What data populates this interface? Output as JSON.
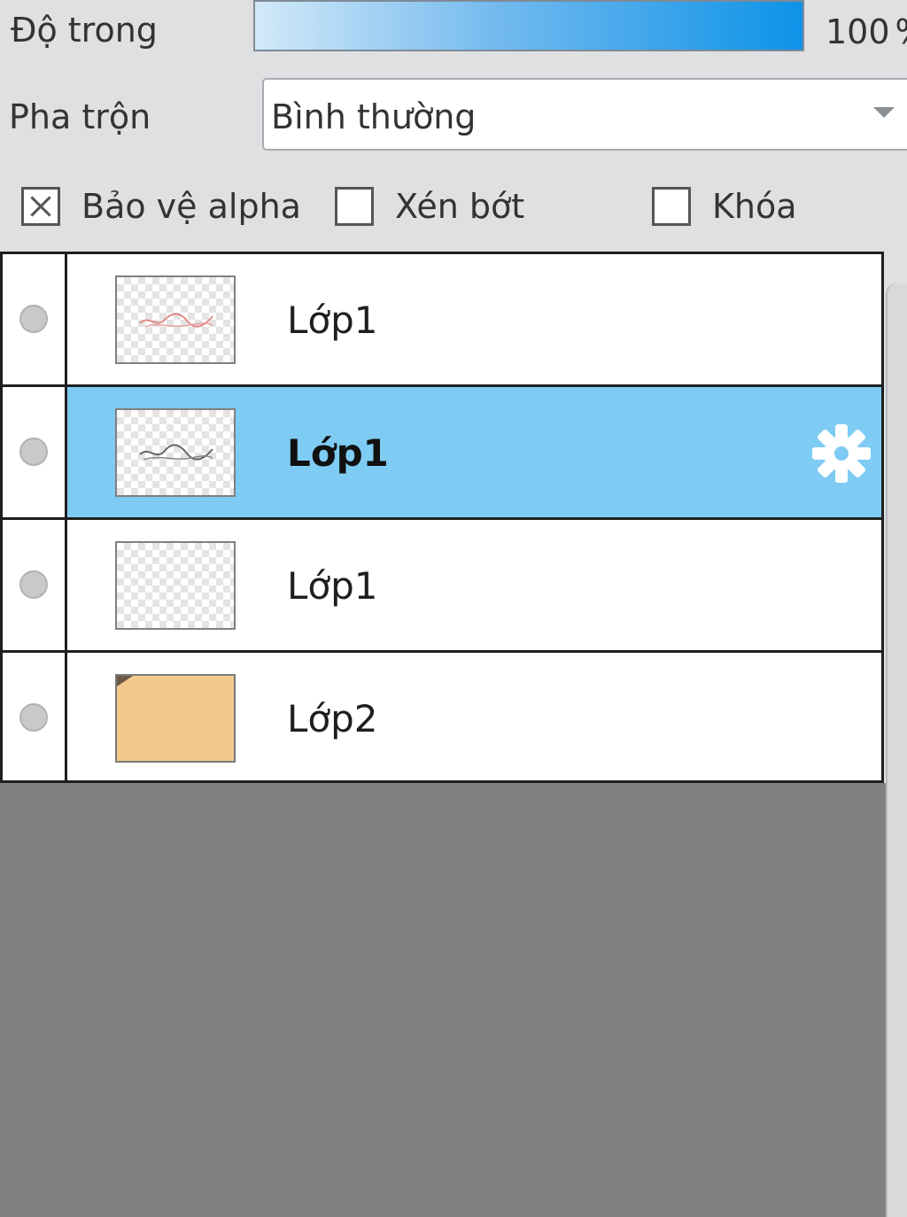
{
  "opacity": {
    "label": "Độ trong",
    "value": "100",
    "unit": "%",
    "level": 1.0
  },
  "blend": {
    "label": "Pha trộn",
    "value": "Bình thường"
  },
  "options": {
    "protect_alpha": {
      "label": "Bảo vệ alpha",
      "checked": true
    },
    "clip": {
      "label": "Xén bớt",
      "checked": false
    },
    "lock": {
      "label": "Khóa",
      "checked": false
    }
  },
  "layers": [
    {
      "name": "Lớp1",
      "selected": false,
      "thumbnail": "transparent-with-red-sketch"
    },
    {
      "name": "Lớp1",
      "selected": true,
      "thumbnail": "transparent-with-dark-sketch",
      "settings_icon": "gear-icon"
    },
    {
      "name": "Lớp1",
      "selected": false,
      "thumbnail": "transparent"
    },
    {
      "name": "Lớp2",
      "selected": false,
      "thumbnail": "solid-fill"
    }
  ],
  "colors": {
    "selected_row": "#7ecbf3",
    "opacity_fill": "#0d93e8",
    "layer2_fill": "#f3c98c",
    "empty_area": "#808080"
  }
}
